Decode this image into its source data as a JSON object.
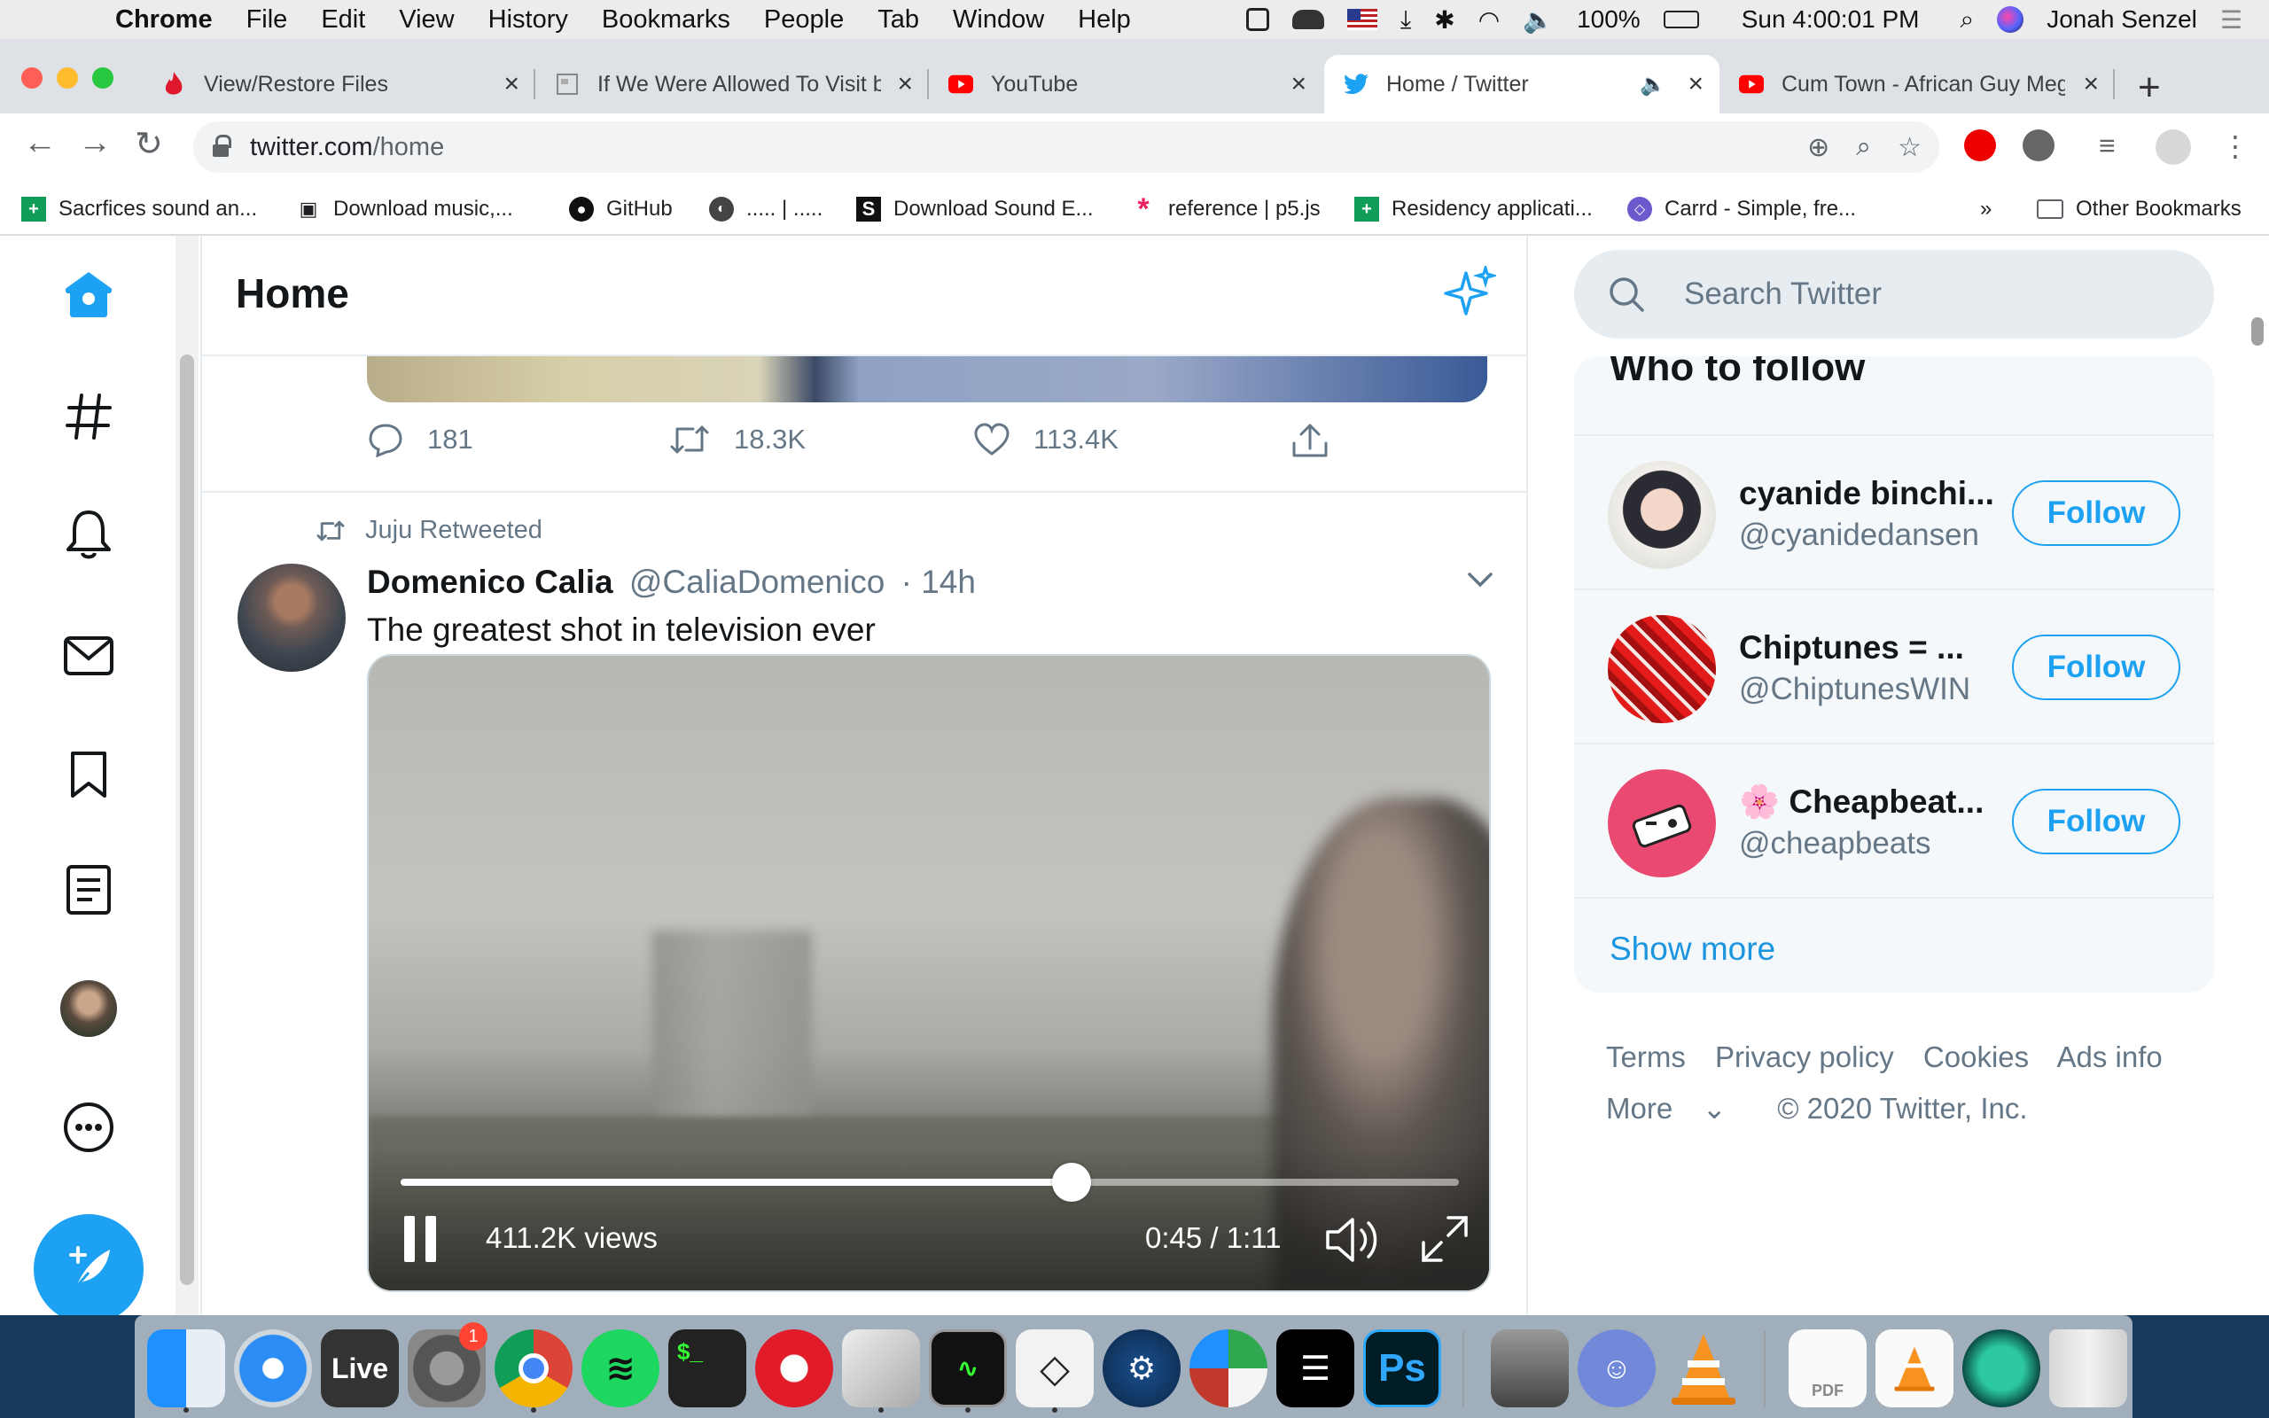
{
  "menubar": {
    "app": "Chrome",
    "items": [
      "File",
      "Edit",
      "View",
      "History",
      "Bookmarks",
      "People",
      "Tab",
      "Window",
      "Help"
    ],
    "battery": "100%",
    "clock": "Sun 4:00:01 PM",
    "user": "Jonah Senzel"
  },
  "tabs": [
    {
      "title": "View/Restore Files",
      "icon": "flame-icon",
      "close": "×"
    },
    {
      "title": "If We Were Allowed To Visit by",
      "icon": "page-icon",
      "close": "×"
    },
    {
      "title": "YouTube",
      "icon": "youtube-icon",
      "close": "×"
    },
    {
      "title": "Home / Twitter",
      "icon": "twitter-icon",
      "close": "×"
    },
    {
      "title": "Cum Town - African Guy Meg",
      "icon": "youtube-icon",
      "close": "×"
    }
  ],
  "new_tab": "+",
  "address": {
    "host": "twitter.com",
    "path": "/home"
  },
  "bookmarks": [
    {
      "label": "Sacrfices sound an...",
      "icon": "sheets-icon"
    },
    {
      "label": "Download music,...",
      "icon": "robot-icon"
    },
    {
      "label": "GitHub",
      "icon": "github-icon"
    },
    {
      "label": "..... | .....",
      "icon": "globe-icon"
    },
    {
      "label": "Download Sound E...",
      "icon": "s-icon"
    },
    {
      "label": "reference | p5.js",
      "icon": "asterisk-icon"
    },
    {
      "label": "Residency applicati...",
      "icon": "sheets-icon"
    },
    {
      "label": "Carrd - Simple, fre...",
      "icon": "carrd-icon"
    }
  ],
  "bookmarks_overflow": "»",
  "other_bookmarks": "Other Bookmarks",
  "timeline": {
    "title": "Home",
    "prev_tweet": {
      "replies": "181",
      "retweets": "18.3K",
      "likes": "113.4K"
    },
    "tweet": {
      "retweeted_by": "Juju Retweeted",
      "name": "Domenico Calia",
      "handle": "@CaliaDomenico",
      "time": "· 14h",
      "text": "The greatest shot in television ever",
      "video": {
        "views": "411.2K views",
        "time": "0:45 / 1:11",
        "progress": 0.634
      }
    }
  },
  "sidebar": {
    "search_placeholder": "Search Twitter",
    "who_to_follow": "Who to follow",
    "suggestions": [
      {
        "name": "cyanide binchi...",
        "handle": "@cyanidedansen",
        "follow": "Follow"
      },
      {
        "name": "Chiptunes = ...",
        "handle": "@ChiptunesWIN",
        "follow": "Follow"
      },
      {
        "name": "🌸 Cheapbeat...",
        "handle": "@cheapbeats",
        "follow": "Follow"
      }
    ],
    "show_more": "Show more",
    "footer": {
      "links": [
        "Terms",
        "Privacy policy",
        "Cookies",
        "Ads info"
      ],
      "more": "More",
      "copyright": "© 2020 Twitter, Inc."
    }
  },
  "dock": {
    "live_label": "Live",
    "terminal_label": "$_",
    "ps_label": "Ps",
    "pdf_label": "PDF",
    "system_prefs_badge": "1"
  },
  "colors": {
    "twitter_blue": "#1da1f2",
    "link_blue": "#1b95e0",
    "muted": "#657786"
  }
}
